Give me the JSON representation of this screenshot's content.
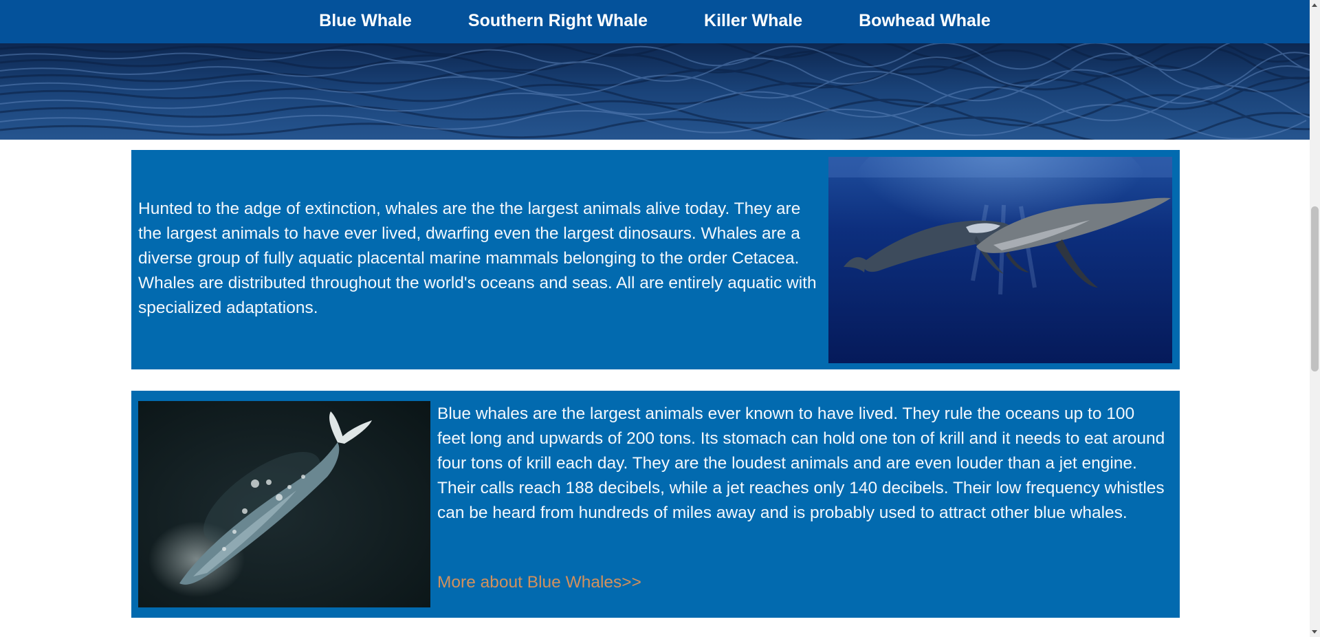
{
  "nav": {
    "items": [
      {
        "label": "Blue Whale"
      },
      {
        "label": "Southern Right Whale"
      },
      {
        "label": "Killer Whale"
      },
      {
        "label": "Bowhead Whale"
      }
    ]
  },
  "intro": {
    "text": "Hunted to the adge of extinction, whales are the the largest animals alive today. They are the largest animals to have ever lived, dwarfing even the largest dinosaurs. Whales are a diverse group of fully aquatic placental marine mammals belonging to the order Cetacea. Whales are distributed throughout the world's oceans and seas. All are entirely aquatic with specialized adaptations."
  },
  "blue_whale": {
    "text": "Blue whales are the largest animals ever known to have lived. They rule the oceans up to 100 feet long and upwards of 200 tons. Its stomach can hold one ton of krill and it needs to eat around four tons of krill each day. They are the loudest animals and are even louder than a jet engine. Their calls reach 188 decibels, while a jet reaches only 140 decibels. Their low frequency whistles can be heard from hundreds of miles away and is probably used to attract other blue whales.",
    "more_link": "More about Blue Whales>>"
  },
  "colors": {
    "nav_background": "#04529b",
    "section_background": "#026aaf",
    "link_color": "#d2915d",
    "text_color": "#f3f8fc"
  }
}
